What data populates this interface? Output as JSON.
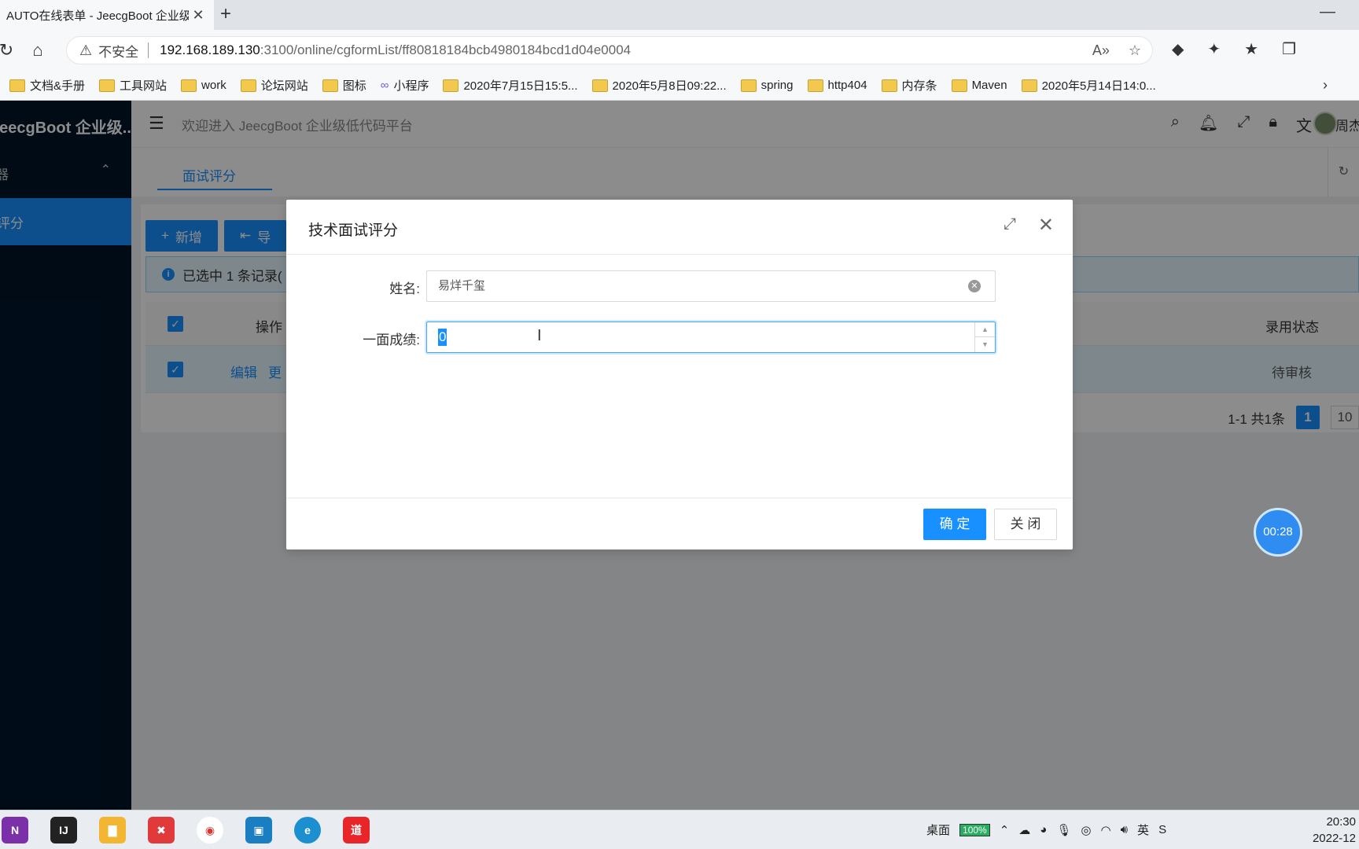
{
  "browser": {
    "tab_title": "AUTO在线表单 - JeecgBoot 企业级",
    "tab_close": "✕",
    "new_tab": "+",
    "insecure_label": "不安全",
    "url_host": "192.168.189.130",
    "url_path": ":3100/online/cgformList/ff80818184bcb4980184bcd1d04e0004",
    "bookmarks": [
      {
        "label": "文档&手册",
        "icon": "folder-icon"
      },
      {
        "label": "工具网站",
        "icon": "folder-icon"
      },
      {
        "label": "work",
        "icon": "folder-icon"
      },
      {
        "label": "论坛网站",
        "icon": "folder-icon"
      },
      {
        "label": "图标",
        "icon": "folder-icon"
      },
      {
        "label": "小程序",
        "icon": "link-icon"
      },
      {
        "label": "2020年7月15日15:5...",
        "icon": "folder-icon"
      },
      {
        "label": "2020年5月8日09:22...",
        "icon": "folder-icon"
      },
      {
        "label": "spring",
        "icon": "folder-icon"
      },
      {
        "label": "http404",
        "icon": "folder-icon"
      },
      {
        "label": "内存条",
        "icon": "folder-icon"
      },
      {
        "label": "Maven",
        "icon": "folder-icon"
      },
      {
        "label": "2020年5月14日14:0...",
        "icon": "folder-icon"
      }
    ]
  },
  "app": {
    "logo_text": "JeecgBoot 企业级...",
    "menu_group_label": "器",
    "menu_item_label": "评分",
    "welcome_text": "欢迎进入 JeecgBoot 企业级低代码平台",
    "user_name": "周杰",
    "page_tab": "面试评分",
    "toolbar": {
      "add_label": "新增",
      "export_label": "导"
    },
    "alert_text": "已选中 1 条记录(",
    "table": {
      "columns": {
        "action": "操作",
        "status": "录用状态"
      },
      "row": {
        "edit": "编辑",
        "more": "更",
        "status": "待审核"
      }
    },
    "pagination": {
      "summary": "1-1 共1条",
      "current_page": "1",
      "page_size": "10"
    }
  },
  "modal": {
    "title": "技术面试评分",
    "fields": {
      "name_label": "姓名:",
      "name_value": "易烊千玺",
      "score_label": "一面成绩:",
      "score_value": "0"
    },
    "ok_label": "确 定",
    "cancel_label": "关 闭"
  },
  "timer": "00:28",
  "taskbar": {
    "desktop_label": "桌面",
    "battery": "100%",
    "ime": "英",
    "time": "20:30",
    "date": "2022-12"
  },
  "colors": {
    "primary": "#1890ff",
    "sidebar_bg": "#001529",
    "overlay": "rgba(0,0,0,0.45)"
  }
}
